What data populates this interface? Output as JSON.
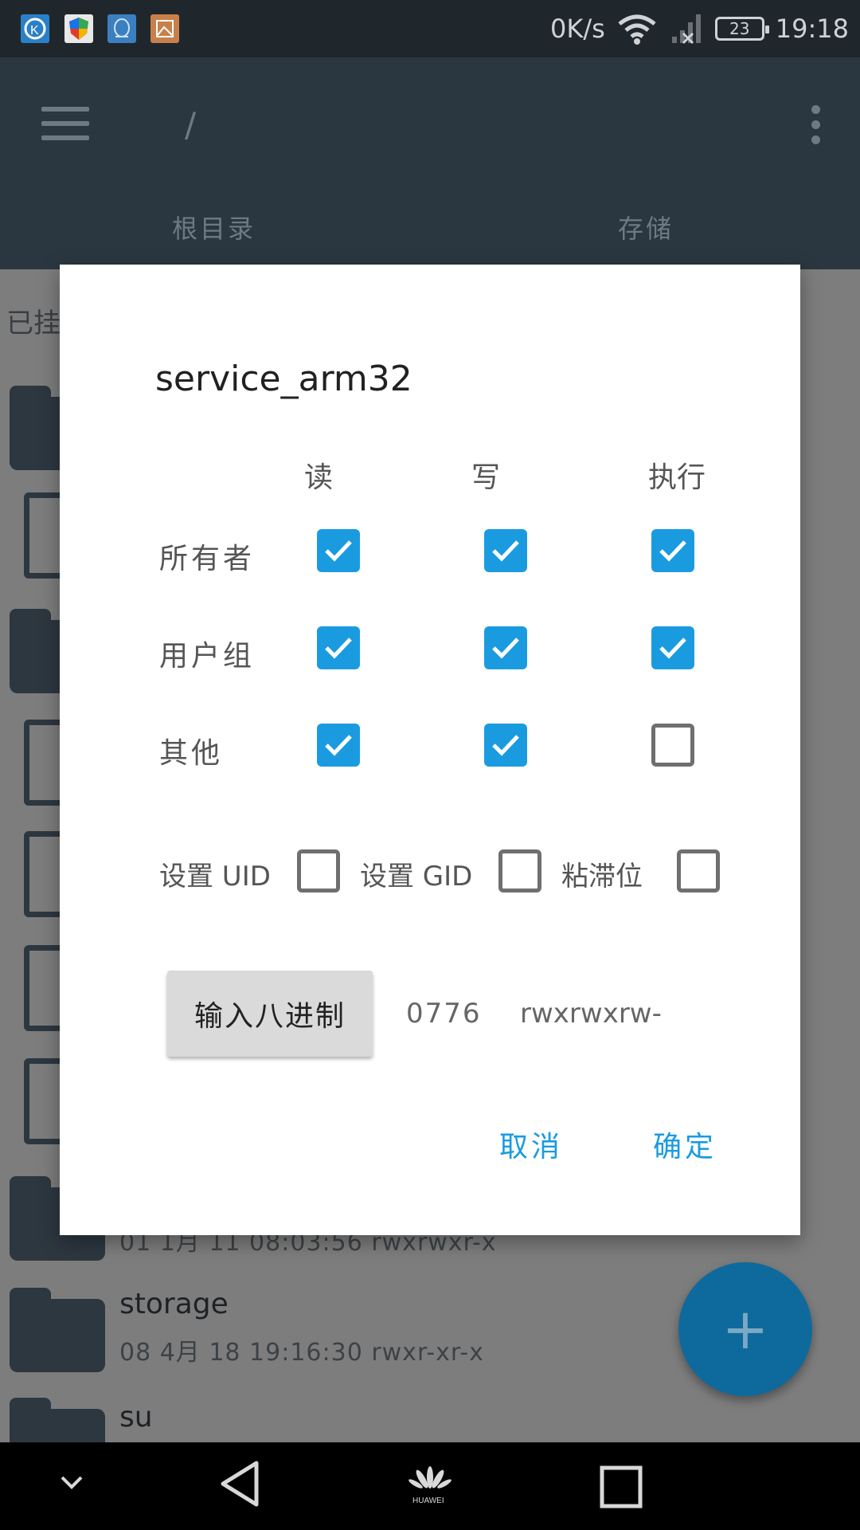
{
  "status_bar": {
    "icons": [
      "k-app-icon",
      "shield-app-icon",
      "qq-app-icon",
      "gallery-app-icon"
    ],
    "net_speed": "0K/s",
    "battery": "23",
    "time": "19:18"
  },
  "app_bar": {
    "path": "/",
    "tabs": [
      "根目录",
      "存储"
    ]
  },
  "list": {
    "mounted_label": "已挂",
    "items": [
      {
        "name": "",
        "meta": "01 1月 11 08:03:56  rwxrwxr-x"
      },
      {
        "name": "storage",
        "meta": "08 4月 18 19:16:30  rwxr-xr-x"
      },
      {
        "name": "su",
        "meta": ""
      }
    ]
  },
  "dialog": {
    "title": "service_arm32",
    "columns": [
      "读",
      "写",
      "执行"
    ],
    "rows": [
      {
        "label": "所有者",
        "read": true,
        "write": true,
        "exec": true
      },
      {
        "label": "用户组",
        "read": true,
        "write": true,
        "exec": true
      },
      {
        "label": "其他",
        "read": true,
        "write": true,
        "exec": false
      }
    ],
    "special": [
      {
        "label": "设置 UID",
        "checked": false
      },
      {
        "label": "设置 GID",
        "checked": false
      },
      {
        "label": "粘滞位",
        "checked": false
      }
    ],
    "octal_button": "输入八进制",
    "octal_value": "0776",
    "perm_string": "rwxrwxrw-",
    "cancel": "取消",
    "ok": "确定"
  },
  "colors": {
    "accent": "#1a9be0",
    "appbar": "#2b3740",
    "fab": "#0e6a9c"
  }
}
